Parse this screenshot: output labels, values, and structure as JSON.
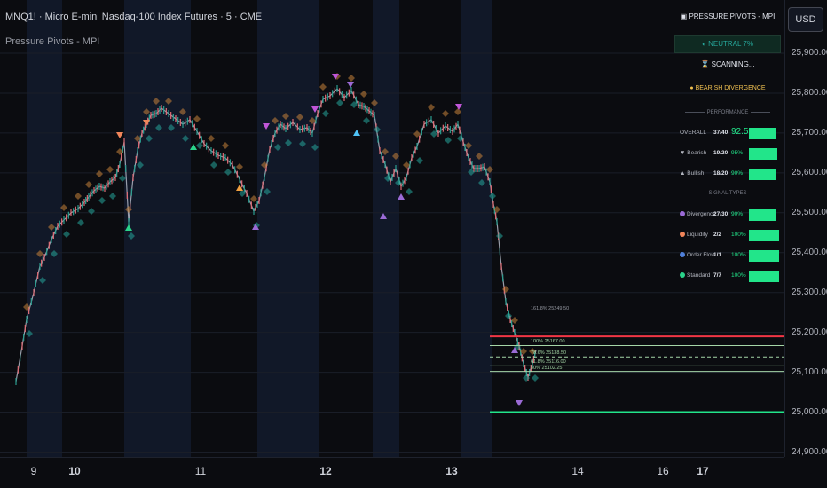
{
  "header": {
    "symbol_title": "MNQ1! · Micro E-mini Nasdaq-100 Index Futures · 5 · CME",
    "indicator_name": "Pressure Pivots - MPI",
    "currency_button": "USD"
  },
  "y_axis": {
    "ticks": [
      "25,900.00",
      "25,800.00",
      "25,700.00",
      "25,600.00",
      "25,500.00",
      "25,400.00",
      "25,300.00",
      "25,200.00",
      "25,100.00",
      "25,000.00",
      "24,900.00"
    ],
    "tick_values": [
      25900,
      25800,
      25700,
      25600,
      25500,
      25400,
      25300,
      25200,
      25100,
      25000,
      24900
    ]
  },
  "x_axis": {
    "ticks": [
      {
        "label": "9",
        "bold": false
      },
      {
        "label": "10",
        "bold": true
      },
      {
        "label": "11",
        "bold": false
      },
      {
        "label": "12",
        "bold": true
      },
      {
        "label": "13",
        "bold": true
      },
      {
        "label": "14",
        "bold": false
      },
      {
        "label": "16",
        "bold": false
      },
      {
        "label": "17",
        "bold": true
      }
    ]
  },
  "panel": {
    "title": "▣ PRESSURE PIVOTS - MPI",
    "state": "◐ NEUTRAL 7%",
    "scanning": "⌛ SCANNING...",
    "divergence": "● BEARISH DIVERGENCE",
    "performance_header": "PERFORMANCE",
    "performance": [
      {
        "label": "OVERALL",
        "icon": "",
        "count": "37/40",
        "pct": "92.5%",
        "big": true
      },
      {
        "label": "Bearish",
        "icon": "▼",
        "count": "19/20",
        "pct": "95%",
        "big": false
      },
      {
        "label": "Bullish",
        "icon": "▲",
        "count": "18/20",
        "pct": "90%",
        "big": false
      }
    ],
    "signal_header": "SIGNAL TYPES",
    "signals": [
      {
        "label": "Divergence",
        "count": "27/30",
        "pct": "90%",
        "dot": "#9b6bd6"
      },
      {
        "label": "Liquidity",
        "count": "2/2",
        "pct": "100%",
        "dot": "#f0855a"
      },
      {
        "label": "Order Flow",
        "count": "1/1",
        "pct": "100%",
        "dot": "#4f7fd8"
      },
      {
        "label": "Standard",
        "count": "7/7",
        "pct": "100%",
        "dot": "#2ad38a"
      }
    ]
  },
  "levels": [
    {
      "label": "161.8% 25249.50",
      "value": 25249.5,
      "color": "#9598a1",
      "style": "none"
    },
    {
      "label": "",
      "value": 25190,
      "color": "#f23645",
      "style": "solid-thick"
    },
    {
      "label": "100% 25167.00",
      "value": 25167,
      "color": "#a5d6a7",
      "style": "solid"
    },
    {
      "label": "78.6% 25138.50",
      "value": 25138.5,
      "color": "#a5d6a7",
      "style": "dashed"
    },
    {
      "label": "61.8% 25116.00",
      "value": 25116,
      "color": "#a5d6a7",
      "style": "solid"
    },
    {
      "label": "50% 25102.25",
      "value": 25102.25,
      "color": "#a5d6a7",
      "style": "solid"
    },
    {
      "label": "",
      "value": 25000,
      "color": "#22e58a",
      "style": "solid-thick"
    }
  ],
  "colors": {
    "background": "#0b0c10",
    "session_band": "#121a2b",
    "bull_candle": "#2a9d8f",
    "bear_candle": "#e06c75",
    "bull_marker": "#26a69a",
    "bear_marker": "#c8843a",
    "accent_green": "#22e58a",
    "accent_red": "#f23645"
  }
}
